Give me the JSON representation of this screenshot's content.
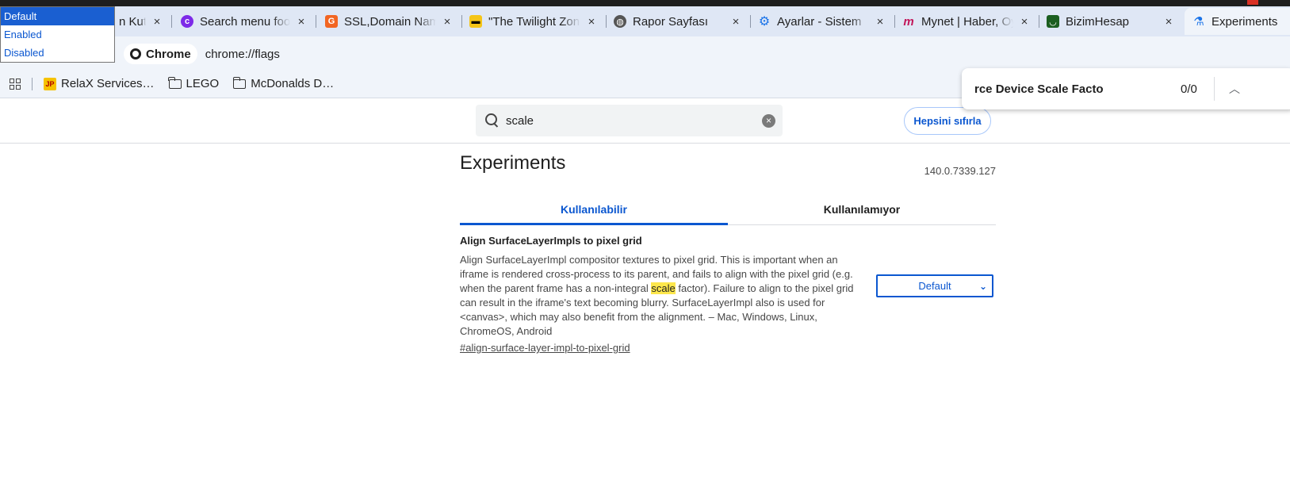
{
  "tabs": [
    {
      "title": "n Kutu",
      "favicon": "mail-icon"
    },
    {
      "title": "Search menu food",
      "favicon": "canva-icon"
    },
    {
      "title": "SSL,Domain Name",
      "favicon": "bestdns-icon"
    },
    {
      "title": "\"The Twilight Zone",
      "favicon": "imdb-icon"
    },
    {
      "title": "Rapor Sayfası",
      "favicon": "globe-icon"
    },
    {
      "title": "Ayarlar - Sistem",
      "favicon": "gear-icon"
    },
    {
      "title": "Mynet | Haber, Oyun",
      "favicon": "mynet-icon"
    },
    {
      "title": "BizimHesap",
      "favicon": "bizimhesap-icon"
    },
    {
      "title": "Experiments",
      "favicon": "flask-icon"
    }
  ],
  "address": {
    "chip": "Chrome",
    "url": "chrome://flags"
  },
  "bookmarks": [
    {
      "label": "RelaX Services…",
      "icon": "jp-icon"
    },
    {
      "label": "LEGO",
      "icon": "folder-icon"
    },
    {
      "label": "McDonalds D…",
      "icon": "folder-icon"
    }
  ],
  "find": {
    "query": "rce Device Scale Facto",
    "count": "0/0"
  },
  "flags": {
    "search_value": "scale",
    "reset_label": "Hepsini sıfırla",
    "title": "Experiments",
    "version": "140.0.7339.127",
    "tab_available": "Kullanılabilir",
    "tab_unavailable": "Kullanılamıyor",
    "experiment": {
      "name": "Align SurfaceLayerImpls to pixel grid",
      "desc_before": "Align SurfaceLayerImpl compositor textures to pixel grid. This is important when an iframe is rendered cross-process to its parent, and fails to align with the pixel grid (e.g. when the parent frame has a non-integral ",
      "desc_highlight": "scale",
      "desc_after": " factor). Failure to align to the pixel grid can result in the iframe's text becoming blurry. SurfaceLayerImpl also is used for <canvas>, which may also benefit from the alignment. – Mac, Windows, Linux, ChromeOS, Android",
      "link": "#align-surface-layer-impl-to-pixel-grid",
      "selected": "Default"
    }
  },
  "dropdown": {
    "options": [
      "Default",
      "Enabled",
      "Disabled"
    ]
  },
  "colors": {
    "accent": "#0b57d0",
    "tabbar": "#dfe7f5",
    "highlight": "#fde74c"
  }
}
